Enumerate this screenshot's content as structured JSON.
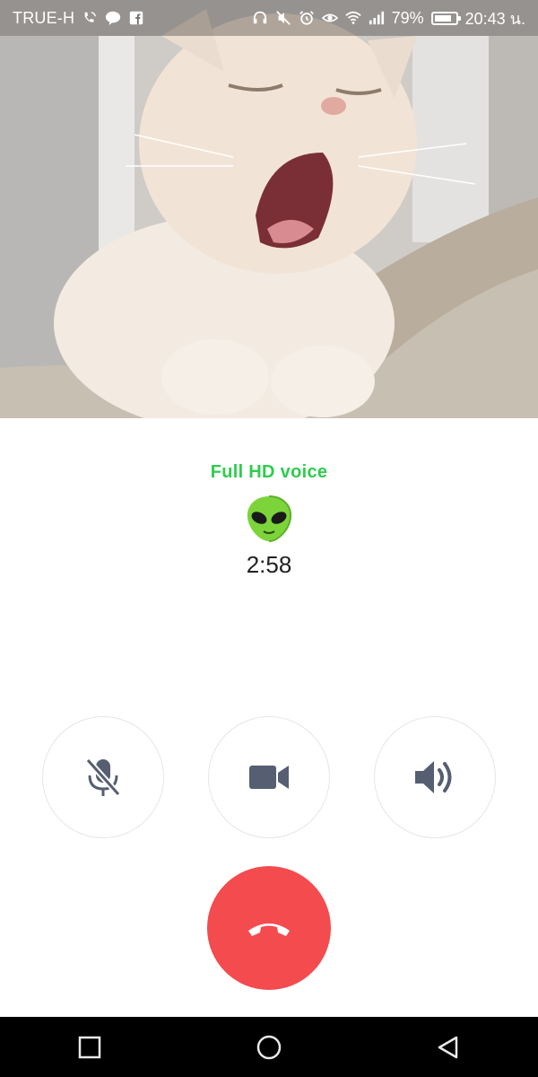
{
  "status_bar": {
    "carrier": "TRUE-H",
    "battery": "79%",
    "time": "20:43 น.",
    "left_icons": [
      "wifi-calling-icon",
      "joy-app-icon",
      "facebook-icon"
    ],
    "right_icons": [
      "headset-icon",
      "vibrate-off-icon",
      "alarm-icon",
      "eye-comfort-icon",
      "wifi-icon",
      "signal-icon",
      "battery-icon"
    ]
  },
  "call": {
    "quality_label": "Full HD voice",
    "avatar_emoji": "👽",
    "duration": "2:58"
  },
  "controls": {
    "mute": "mic-off-icon",
    "video": "video-camera-icon",
    "speaker": "speaker-icon",
    "end_call": "phone-hangup-icon"
  },
  "colors": {
    "accent_green": "#2ecc4e",
    "end_call_red": "#f44b4f",
    "icon_slate": "#565e72"
  }
}
